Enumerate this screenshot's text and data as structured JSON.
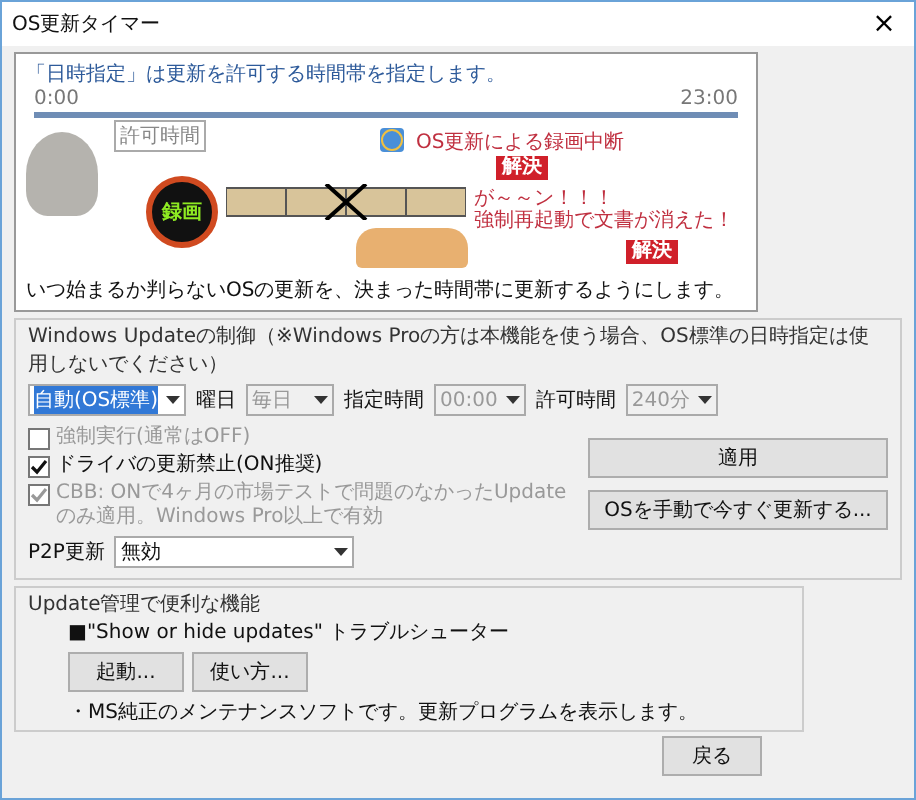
{
  "window": {
    "title": "OS更新タイマー",
    "close": "×"
  },
  "banner": {
    "heading": "「日時指定」は更新を許可する時間帯を指定します。",
    "start": "0:00",
    "end": "23:00",
    "window_label": "許可時間",
    "tv_label": "録画",
    "note1": "OS更新による録画中断",
    "badge1": "解決",
    "note2a": "が～～ン！！！",
    "note2b": "強制再起動で文書が消えた！",
    "badge2": "解決",
    "caption": "いつ始まるか判らないOSの更新を、決まった時間帯に更新するようにします。"
  },
  "control": {
    "legend": "Windows Updateの制御（※Windows Proの方は本機能を使う場合、OS標準の日時指定は使用しないでください）",
    "mode": {
      "value": "自動(OS標準)",
      "disabled": false,
      "selected": true
    },
    "day": {
      "label": "曜日",
      "value": "毎日",
      "disabled": true
    },
    "time": {
      "label": "指定時間",
      "value": "00:00",
      "disabled": true
    },
    "allow": {
      "label": "許可時間",
      "value": "240分",
      "disabled": true
    },
    "checks": [
      {
        "label": "強制実行(通常はOFF)",
        "checked": false,
        "disabled": true
      },
      {
        "label": "ドライバの更新禁止(ON推奨)",
        "checked": true,
        "disabled": false
      },
      {
        "label": "CBB: ONで4ヶ月の市場テストで問題のなかったUpdateのみ適用。Windows Pro以上で有効",
        "checked": true,
        "disabled": true
      }
    ],
    "p2p": {
      "label": "P2P更新",
      "value": "無効",
      "disabled": false
    },
    "buttons": [
      "適用",
      "OSを手動で今すぐ更新する..."
    ]
  },
  "tools": {
    "legend": "Update管理で便利な機能",
    "title": "■\"Show or hide updates\" トラブルシューター",
    "buttons": [
      "起動...",
      "使い方..."
    ],
    "note": "・MS純正のメンテナンスソフトです。更新プログラムを表示します。"
  },
  "back": "戻る"
}
